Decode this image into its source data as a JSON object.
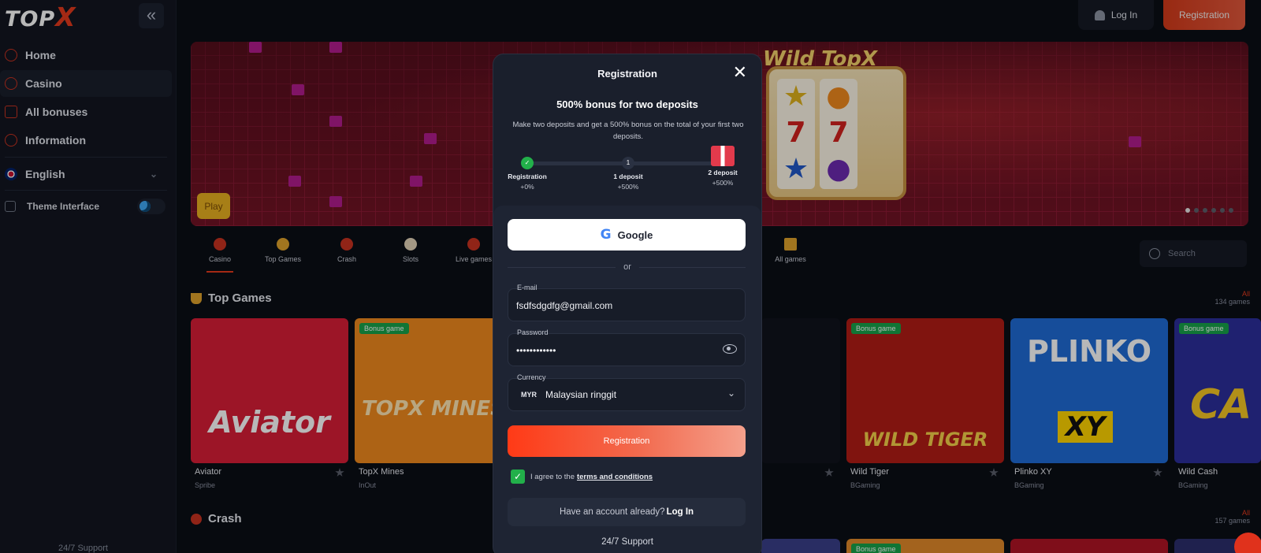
{
  "sidebar": {
    "logo_text": "TOP",
    "logo_x": "X",
    "collapse_glyph": "«",
    "items": [
      {
        "label": "Home",
        "icon": "home-icon"
      },
      {
        "label": "Casino",
        "icon": "casino-chip-icon"
      },
      {
        "label": "All bonuses",
        "icon": "gift-icon"
      },
      {
        "label": "Information",
        "icon": "info-icon"
      }
    ],
    "language": "English",
    "theme_label": "Theme Interface",
    "support": "24/7 Support"
  },
  "header": {
    "login_label": "Log In",
    "registration_label": "Registration"
  },
  "banner": {
    "slot_title": "Wild TopX",
    "play_label": "Play",
    "reel_symbols": [
      "7",
      "7"
    ],
    "slide_count": 6,
    "active_slide": 1
  },
  "categories": [
    {
      "label": "Casino",
      "active": true
    },
    {
      "label": "Top Games",
      "active": false
    },
    {
      "label": "Crash",
      "active": false
    },
    {
      "label": "Slots",
      "active": false
    },
    {
      "label": "Live games",
      "active": false
    },
    {
      "label": "All games",
      "active": false
    }
  ],
  "search": {
    "placeholder": "Search"
  },
  "top_games": {
    "title": "Top Games",
    "all_label": "All",
    "count_label": "134 games",
    "cards": [
      {
        "name": "Aviator",
        "provider": "Spribe",
        "art": "Aviator",
        "color": "#d81e36"
      },
      {
        "name": "TopX Mines",
        "provider": "InOut",
        "art": "TOPX MINES",
        "color": "#f08a1e",
        "badge": "Bonus game"
      },
      {
        "name": "Wild Tiger",
        "provider": "BGaming",
        "art": "WILD TIGER",
        "color": "#b21d16",
        "badge": "Bonus game"
      },
      {
        "name": "Plinko XY",
        "provider": "BGaming",
        "art": "PLINKO",
        "color": "#1f6bd6"
      },
      {
        "name": "Wild Cash",
        "provider": "BGaming",
        "art": "CA",
        "color": "#2b2f9c",
        "badge": "Bonus game"
      }
    ]
  },
  "crash": {
    "title": "Crash",
    "all_label": "All",
    "count_label": "157 games",
    "first_badge": "Bonus game"
  },
  "modal": {
    "title": "Registration",
    "promo_title": "500% bonus for two deposits",
    "promo_desc": "Make two deposits and get a 500% bonus on the total of your first two deposits.",
    "steps": [
      {
        "label": "Registration",
        "bonus": "+0%",
        "marker": "✓"
      },
      {
        "label": "1 deposit",
        "bonus": "+500%",
        "marker": "1"
      },
      {
        "label": "2 deposit",
        "bonus": "+500%",
        "marker": "gift"
      }
    ],
    "google_label": "Google",
    "or_label": "or",
    "email": {
      "label": "E-mail",
      "value": "fsdfsdgdfg@gmail.com"
    },
    "password": {
      "label": "Password",
      "value": "••••••••••••"
    },
    "currency": {
      "label": "Currency",
      "code": "MYR",
      "name": "Malaysian ringgit"
    },
    "submit_label": "Registration",
    "agree_text": "I agree to the",
    "terms_label": "terms and conditions",
    "agree_checked": true,
    "have_account": "Have an account already?",
    "login_link": "Log In",
    "support": "24/7 Support"
  },
  "colors": {
    "accent": "#e33a1c",
    "bg": "#0b0e16",
    "sidebar": "#121620",
    "modal": "#1a1f2c",
    "success": "#22b04a"
  }
}
